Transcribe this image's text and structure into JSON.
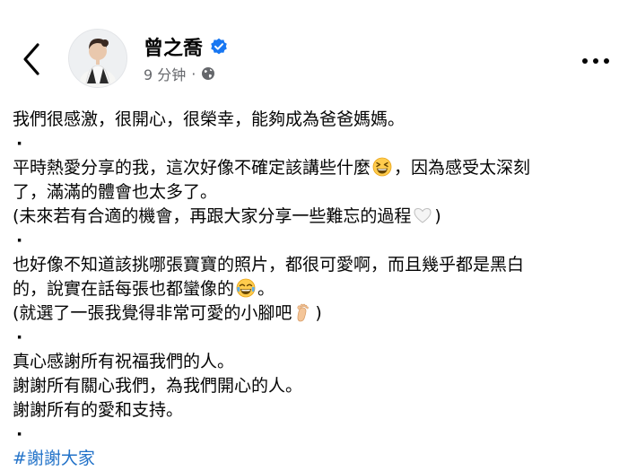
{
  "header": {
    "author_name": "曾之喬",
    "timestamp": "9 分钟",
    "icons": [
      "back-arrow-icon",
      "avatar",
      "verified-badge-icon",
      "globe-icon",
      "more-options-icon"
    ],
    "accent_color": "#1877f2",
    "meta_color": "#65676b"
  },
  "post": {
    "line1": "我們很感激，很開心，很榮幸，能夠成為爸爸媽媽。",
    "dot": "·",
    "line2a": "平時熱愛分享的我，這次好像不確定該講些什麼",
    "line2b": "，因為感受太深刻",
    "line3": "了，滿滿的體會也太多了。",
    "line4a": "(未來若有合適的機會，再跟大家分享一些難忘的過程",
    "line4b": ")",
    "line5": "也好像不知道該挑哪張寶寶的照片，都很可愛啊，而且幾乎都是黑白",
    "line6a": "的，說實在話每張也都蠻像的",
    "line6b": "。",
    "line7a": "(就選了一張我覺得非常可愛的小腳吧",
    "line7b": ")",
    "line8": "真心感謝所有祝福我們的人。",
    "line9": "謝謝所有關心我們，為我們開心的人。",
    "line10": "謝謝所有的愛和支持。",
    "hashtag": "#謝謝大家",
    "hashtag_color": "#2373c9",
    "emojis": [
      "grinning-squinting-face-emoji",
      "white-heart-emoji",
      "tears-of-joy-emoji",
      "foot-emoji"
    ]
  }
}
